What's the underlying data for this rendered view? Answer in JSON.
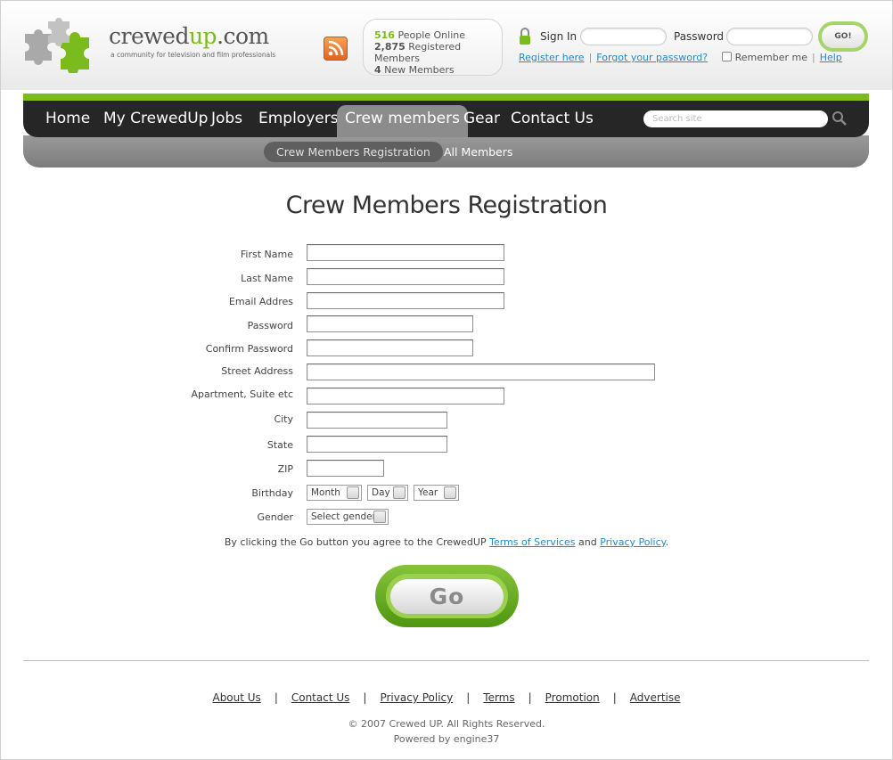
{
  "header": {
    "logo": {
      "name_main": "crewed",
      "name_accent": "up",
      "name_suffix": ".com",
      "tagline": "a community for television and film professionals"
    },
    "stats": [
      {
        "count": "516",
        "label": "People Online"
      },
      {
        "count": "2,875",
        "label": "Registered Members"
      },
      {
        "count": "4",
        "label": "New Members"
      }
    ],
    "signin": {
      "label": "Sign In",
      "password_label": "Password",
      "username_value": "",
      "password_value": "",
      "go_label": "GO!",
      "register_link": "Register here",
      "forgot_link": "Forgot your password?",
      "remember_label": "Remember me",
      "help_link": "Help"
    }
  },
  "nav": {
    "items": [
      "Home",
      "My CrewedUp",
      "Jobs",
      "Employers",
      "Crew members",
      "Gear",
      "Contact Us"
    ],
    "active": "Crew members",
    "search_placeholder": "Search site",
    "subnav": [
      "Crew Members Registration",
      "All Members"
    ]
  },
  "main": {
    "title": "Crew Members Registration",
    "fields": [
      {
        "label": "First Name",
        "value": ""
      },
      {
        "label": "Last Name",
        "value": ""
      },
      {
        "label": "Email Addres",
        "value": ""
      },
      {
        "label": "Password",
        "value": ""
      },
      {
        "label": "Confirm Password",
        "value": ""
      },
      {
        "label": "Street Address",
        "value": ""
      },
      {
        "label": "Apartment, Suite etc",
        "value": ""
      },
      {
        "label": "City",
        "value": ""
      },
      {
        "label": "State",
        "value": ""
      },
      {
        "label": "ZIP",
        "value": ""
      }
    ],
    "birthday": {
      "label": "Birthday",
      "month": "Month",
      "day": "Day",
      "year": "Year"
    },
    "gender": {
      "label": "Gender",
      "value": "Select gender"
    },
    "agreement": {
      "prefix": "By clicking the Go button you agree to the CrewedUP",
      "terms_link": "Terms of Services",
      "and": "and",
      "privacy_link": "Privacy Policy",
      "suffix": "."
    },
    "go_label": "Go"
  },
  "footer": {
    "links": [
      "About Us",
      "Contact Us",
      "Privacy Policy",
      "Terms",
      "Promotion",
      "Advertise"
    ],
    "separator": "|",
    "copyright": "© 2007 Crewed UP. All Rights Reserved.",
    "powered": "Powered by engine37"
  },
  "colors": {
    "accent_green": "#7cbb1e",
    "link_blue": "#2a88c7",
    "nav_dark": "#262626",
    "nav_active": "#8c8c8c"
  }
}
